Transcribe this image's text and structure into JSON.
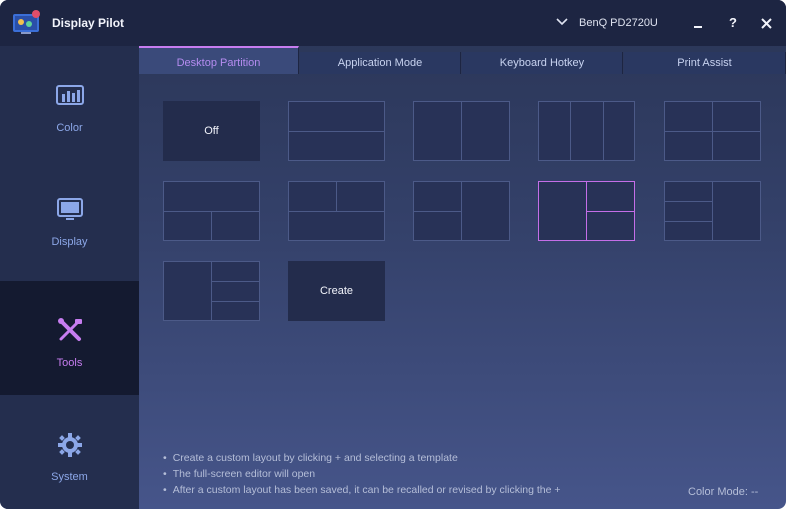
{
  "app": {
    "title": "Display Pilot",
    "monitor": "BenQ PD2720U"
  },
  "window_buttons": {
    "minimize": "_",
    "help": "?",
    "close": "✕"
  },
  "sidebar": {
    "items": [
      {
        "label": "Color",
        "icon": "color-bars-icon",
        "active": false
      },
      {
        "label": "Display",
        "icon": "monitor-icon",
        "active": false
      },
      {
        "label": "Tools",
        "icon": "tools-icon",
        "active": true
      },
      {
        "label": "System",
        "icon": "gear-icon",
        "active": false
      }
    ]
  },
  "tabs": [
    {
      "label": "Desktop Partition",
      "active": true
    },
    {
      "label": "Application Mode",
      "active": false
    },
    {
      "label": "Keyboard Hotkey",
      "active": false
    },
    {
      "label": "Print Assist",
      "active": false
    }
  ],
  "layouts": {
    "off_label": "Off",
    "create_label": "Create",
    "selected": "two-right-split"
  },
  "notes": [
    "Create a custom layout by clicking + and selecting a template",
    "The full-screen editor will open",
    "After a custom layout has been saved, it can be recalled or revised by clicking the +"
  ],
  "status": {
    "color_mode": "Color Mode: --"
  },
  "colors": {
    "accent": "#c77df0",
    "sidebar_label": "#8ca7e8",
    "titlebar": "#1d2542"
  }
}
